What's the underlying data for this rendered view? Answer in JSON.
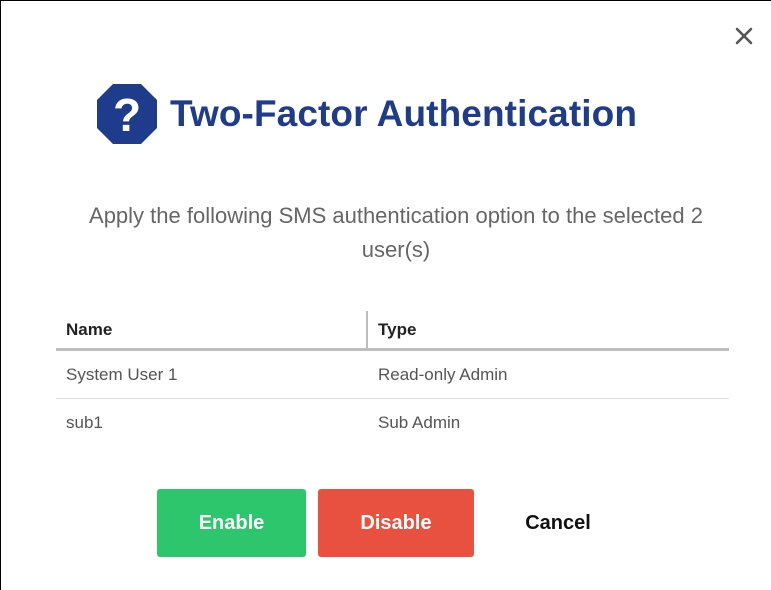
{
  "dialog": {
    "title": "Two-Factor Authentication",
    "message": "Apply the following SMS authentication option to the selected 2 user(s)",
    "close_icon": "close-icon",
    "title_icon": "question-shield-icon",
    "colors": {
      "title": "#1f3b8c",
      "icon": "#1f3b8c",
      "enable": "#2ec66d",
      "disable": "#e8503f"
    }
  },
  "table": {
    "columns": [
      "Name",
      "Type"
    ],
    "rows": [
      {
        "name": "System User 1",
        "type": "Read-only Admin"
      },
      {
        "name": "sub1",
        "type": "Sub Admin"
      }
    ]
  },
  "actions": {
    "enable_label": "Enable",
    "disable_label": "Disable",
    "cancel_label": "Cancel"
  }
}
